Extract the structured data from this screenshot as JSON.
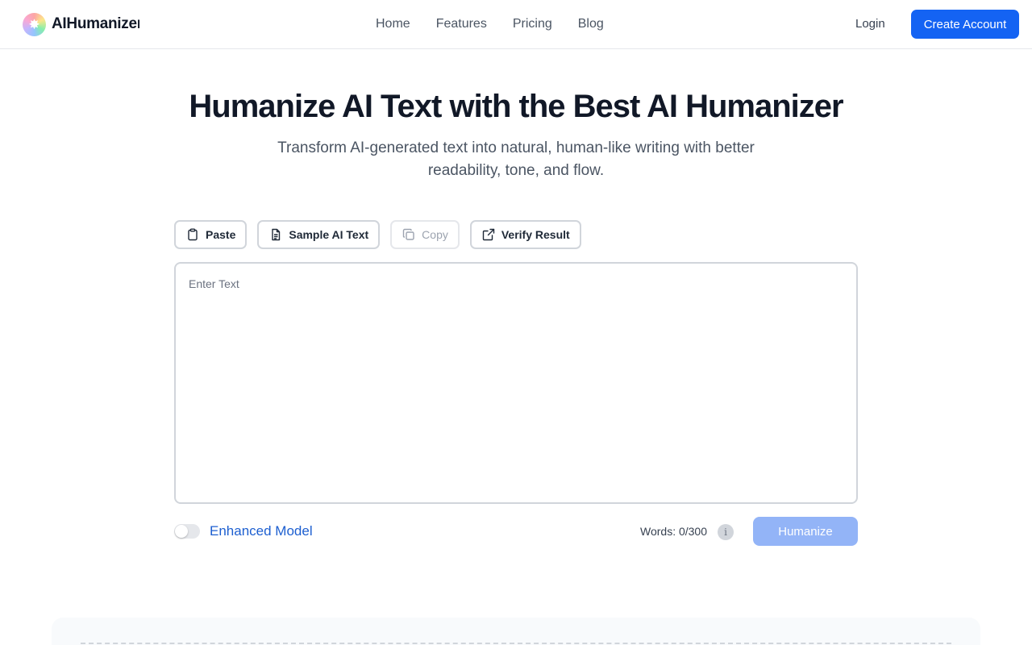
{
  "header": {
    "brand_name": "AIHumanizer",
    "nav": [
      "Home",
      "Features",
      "Pricing",
      "Blog"
    ],
    "login_label": "Login",
    "create_account_label": "Create Account"
  },
  "hero": {
    "title": "Humanize AI Text with the Best AI Humanizer",
    "subtitle": "Transform AI-generated text into natural, human-like writing with better readability, tone, and flow."
  },
  "toolbar": {
    "paste_label": "Paste",
    "sample_label": "Sample AI Text",
    "copy_label": "Copy",
    "verify_label": "Verify Result"
  },
  "editor": {
    "placeholder": "Enter Text",
    "value": ""
  },
  "controls": {
    "enhanced_model_label": "Enhanced Model",
    "enhanced_model_on": false,
    "word_count_label": "Words: 0/300",
    "info_glyph": "i",
    "humanize_label": "Humanize"
  },
  "colors": {
    "primary": "#1463f3",
    "primary_disabled": "#93b4f7",
    "link": "#1d5fd0"
  },
  "icons": {
    "logo": "sparkle-logo-icon",
    "paste": "clipboard-icon",
    "sample": "document-icon",
    "copy": "copy-icon",
    "verify": "external-link-icon",
    "info": "info-icon"
  }
}
